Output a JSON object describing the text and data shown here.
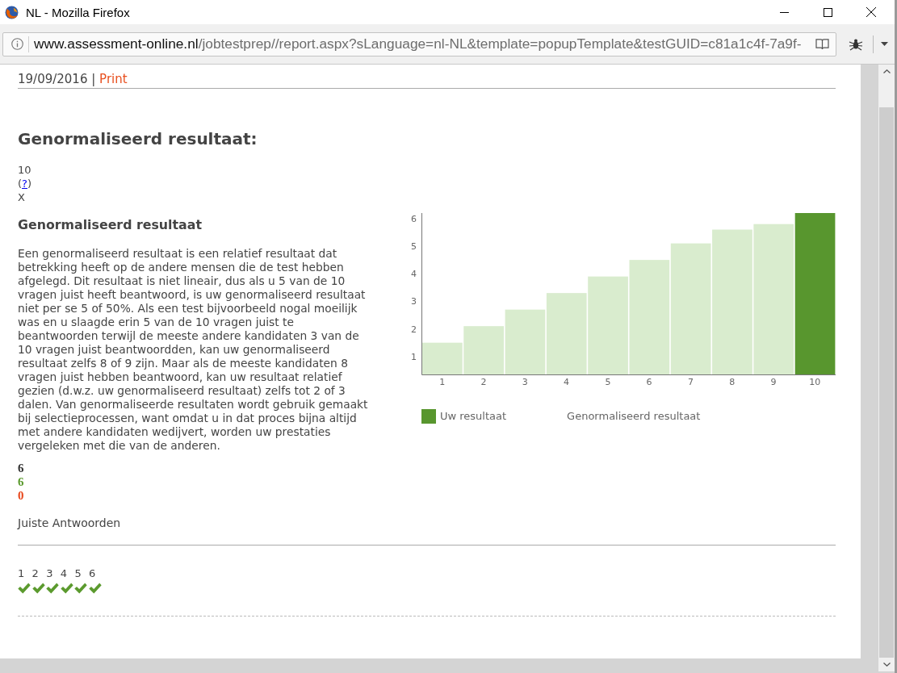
{
  "window": {
    "title": "NL - Mozilla Firefox"
  },
  "address_bar": {
    "host": "www.assessment-online.nl",
    "path": "/jobtestprep//report.aspx?sLanguage=nl-NL&template=popupTemplate&testGUID=c81a1c4f-7a9f-"
  },
  "report": {
    "date": "19/09/2016",
    "separator": "|",
    "print_link": "Print",
    "title": "Genormaliseerd resultaat:",
    "score": "10",
    "help": {
      "before": "(",
      "link": "?",
      "after": ")"
    },
    "mark": "X",
    "explanation": {
      "heading": "Genormaliseerd resultaat",
      "text": "Een genormaliseerd resultaat is een relatief resultaat dat betrekking heeft op de andere mensen die de test hebben afgelegd. Dit resultaat is niet lineair, dus als u 5 van de 10 vragen juist heeft beantwoord, is uw genormaliseerd resultaat niet per se 5 of 50%. Als een test bijvoorbeeld nogal moeilijk was en u slaagde erin 5 van de 10 vragen juist te beantwoorden terwijl de meeste andere kandidaten 3 van de 10 vragen juist beantwoordden, kan uw genormaliseerd resultaat zelfs 8 of 9 zijn. Maar als de meeste kandidaten 8 vragen juist hebben beantwoord, kan uw resultaat relatief gezien (d.w.z. uw genormaliseerd resultaat) zelfs tot 2 of 3 dalen. Van genormaliseerde resultaten wordt gebruik gemaakt bij selectieprocessen, want omdat u in dat proces bijna altijd met andere kandidaten wedijvert, worden uw prestaties vergeleken met die van de anderen."
    },
    "chart_data": {
      "type": "bar",
      "categories": [
        "1",
        "2",
        "3",
        "4",
        "5",
        "6",
        "7",
        "8",
        "9",
        "10"
      ],
      "values": [
        1.5,
        2.1,
        2.7,
        3.3,
        3.9,
        4.5,
        5.1,
        5.6,
        5.8,
        6.2
      ],
      "colors": [
        "#d9ecce",
        "#d9ecce",
        "#d9ecce",
        "#d9ecce",
        "#d9ecce",
        "#d9ecce",
        "#d9ecce",
        "#d9ecce",
        "#d9ecce",
        "#58962e"
      ],
      "yticks": [
        1,
        2,
        3,
        4,
        5,
        6
      ],
      "ylim": [
        0.35,
        6.2
      ]
    },
    "legend": [
      {
        "label": "Uw resultaat",
        "color": "#58962e"
      },
      {
        "label": "Genormaliseerd resultaat"
      }
    ],
    "tallies": [
      {
        "kind": "total",
        "value": "6"
      },
      {
        "kind": "correct",
        "value": "6"
      },
      {
        "kind": "wrong",
        "value": "0"
      }
    ],
    "answers_label": "Juiste Antwoorden",
    "answers": [
      {
        "number": "1",
        "correct": true
      },
      {
        "number": "2",
        "correct": true
      },
      {
        "number": "3",
        "correct": true
      },
      {
        "number": "4",
        "correct": true
      },
      {
        "number": "5",
        "correct": true
      },
      {
        "number": "6",
        "correct": true
      }
    ]
  }
}
